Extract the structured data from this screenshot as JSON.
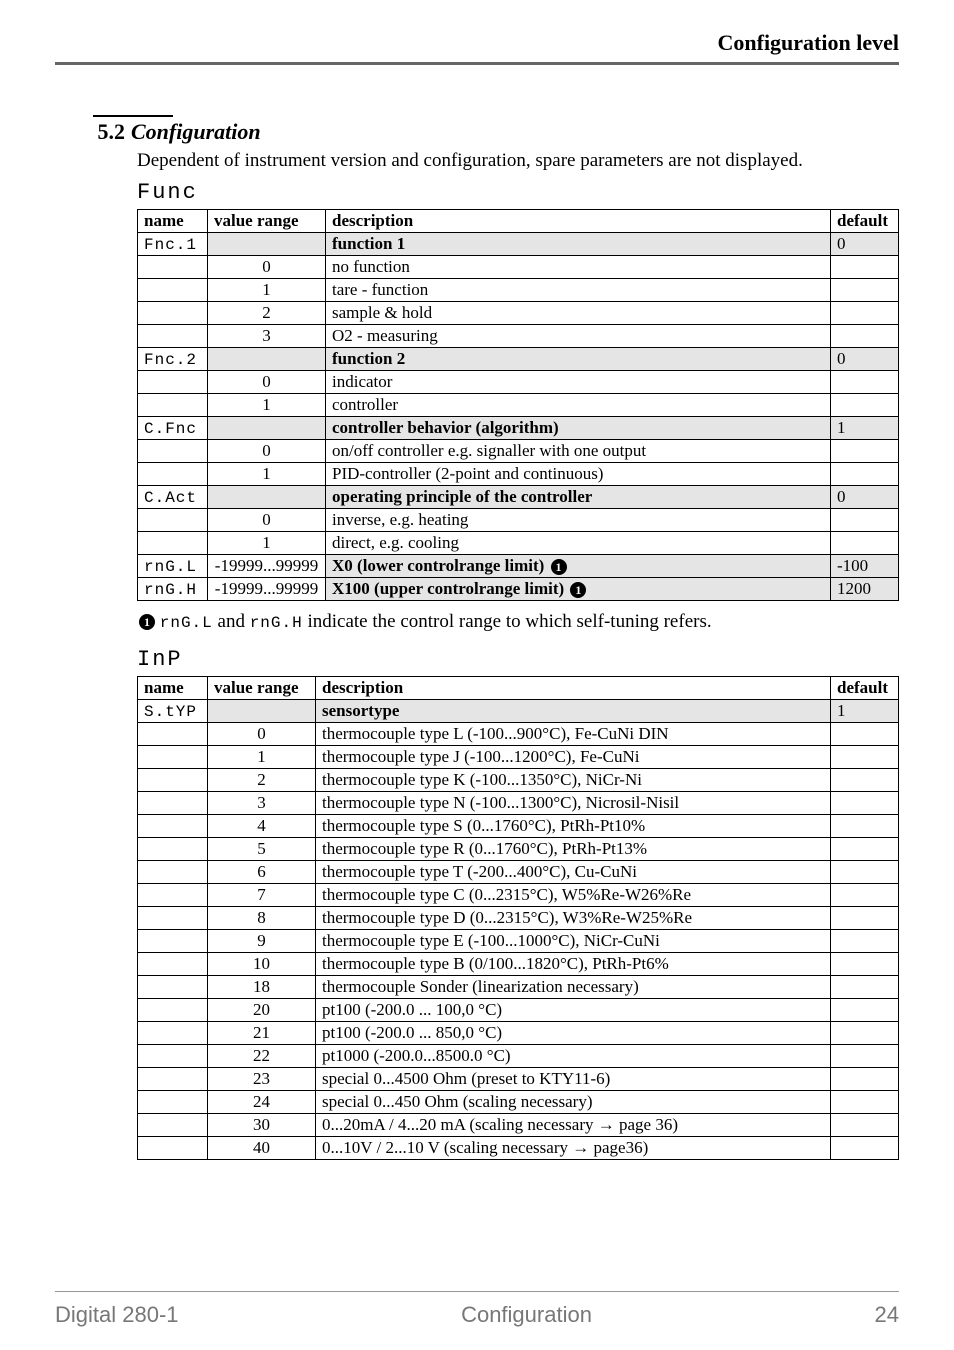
{
  "header": {
    "title": "Configuration level"
  },
  "section": {
    "number": "5.2",
    "title": "Configuration",
    "lead": "Dependent of instrument version and configuration, spare parameters are not displayed."
  },
  "func": {
    "label": "Func",
    "headers": {
      "name": "name",
      "range": "value range",
      "desc": "description",
      "def": "default"
    },
    "groups": [
      {
        "nameSeg": "Fnc.1",
        "title": "function 1",
        "def": "0",
        "rows": [
          {
            "range": "0",
            "desc": "no function"
          },
          {
            "range": "1",
            "desc": "tare - function"
          },
          {
            "range": "2",
            "desc": "sample & hold"
          },
          {
            "range": "3",
            "desc": "O2 - measuring"
          }
        ]
      },
      {
        "nameSeg": "Fnc.2",
        "title": "function 2",
        "def": "0",
        "rows": [
          {
            "range": "0",
            "desc": "indicator"
          },
          {
            "range": "1",
            "desc": "controller"
          }
        ]
      },
      {
        "nameSeg": "C.Fnc",
        "title": "controller behavior (algorithm)",
        "def": "1",
        "rows": [
          {
            "range": "0",
            "desc": "on/off controller e.g. signaller with one output"
          },
          {
            "range": "1",
            "desc": "PID-controller (2-point and continuous)"
          }
        ]
      },
      {
        "nameSeg": "C.Act",
        "title": "operating principle of the controller",
        "def": "0",
        "rows": [
          {
            "range": "0",
            "desc": "inverse, e.g. heating"
          },
          {
            "range": "1",
            "desc": "direct, e.g. cooling"
          }
        ]
      }
    ],
    "singles": [
      {
        "nameSeg": "rnG.L",
        "range": "-19999...99999",
        "desc": "X0 (lower controlrange limit)",
        "badge": "1",
        "def": "-100"
      },
      {
        "nameSeg": "rnG.H",
        "range": "-19999...99999",
        "desc": "X100 (upper controlrange limit)",
        "badge": "1",
        "def": "1200"
      }
    ]
  },
  "note": {
    "badge": "1",
    "seg1": "rnG.L",
    "mid": " and ",
    "seg2": "rnG.H",
    "tail": " indicate the control range to which self-tuning refers."
  },
  "inp": {
    "label": "InP",
    "headers": {
      "name": "name",
      "range": "value range",
      "desc": "description",
      "def": "default"
    },
    "group": {
      "nameSeg": "S.tYP",
      "title": "sensortype",
      "def": "1",
      "rows": [
        {
          "range": "0",
          "desc": "thermocouple type L (-100...900°C), Fe-CuNi DIN"
        },
        {
          "range": "1",
          "desc": "thermocouple  type J (-100...1200°C), Fe-CuNi"
        },
        {
          "range": "2",
          "desc": "thermocouple  type K (-100...1350°C), NiCr-Ni"
        },
        {
          "range": "3",
          "desc": "thermocouple  type N (-100...1300°C), Nicrosil-Nisil"
        },
        {
          "range": "4",
          "desc": "thermocouple  type S (0...1760°C), PtRh-Pt10%"
        },
        {
          "range": "5",
          "desc": "thermocouple  type R (0...1760°C), PtRh-Pt13%"
        },
        {
          "range": "6",
          "desc": "thermocouple  type T (-200...400°C), Cu-CuNi"
        },
        {
          "range": "7",
          "desc": "thermocouple  type C (0...2315°C), W5%Re-W26%Re"
        },
        {
          "range": "8",
          "desc": "thermocouple  type D (0...2315°C), W3%Re-W25%Re"
        },
        {
          "range": "9",
          "desc": "thermocouple  type E (-100...1000°C), NiCr-CuNi"
        },
        {
          "range": "10",
          "desc": "thermocouple  type B (0/100...1820°C), PtRh-Pt6%"
        },
        {
          "range": "18",
          "desc": "thermocouple  Sonder (linearization necessary)"
        },
        {
          "range": "20",
          "desc": "pt100 (-200.0 ... 100,0 °C)"
        },
        {
          "range": "21",
          "desc": "pt100 (-200.0 ... 850,0 °C)"
        },
        {
          "range": "22",
          "desc": "pt1000 (-200.0...8500.0 °C)"
        },
        {
          "range": "23",
          "desc": "special 0...4500 Ohm  (preset to KTY11-6)"
        },
        {
          "range": "24",
          "desc": "special 0...450 Ohm (scaling necessary)"
        },
        {
          "range": "30",
          "desc": "0...20mA / 4...20 mA  (scaling necessary → page 36)"
        },
        {
          "range": "40",
          "desc": "0...10V / 2...10 V        (scaling necessary → page36)"
        }
      ]
    }
  },
  "footer": {
    "left": "Digital 280-1",
    "center": "Configuration",
    "right": "24"
  }
}
